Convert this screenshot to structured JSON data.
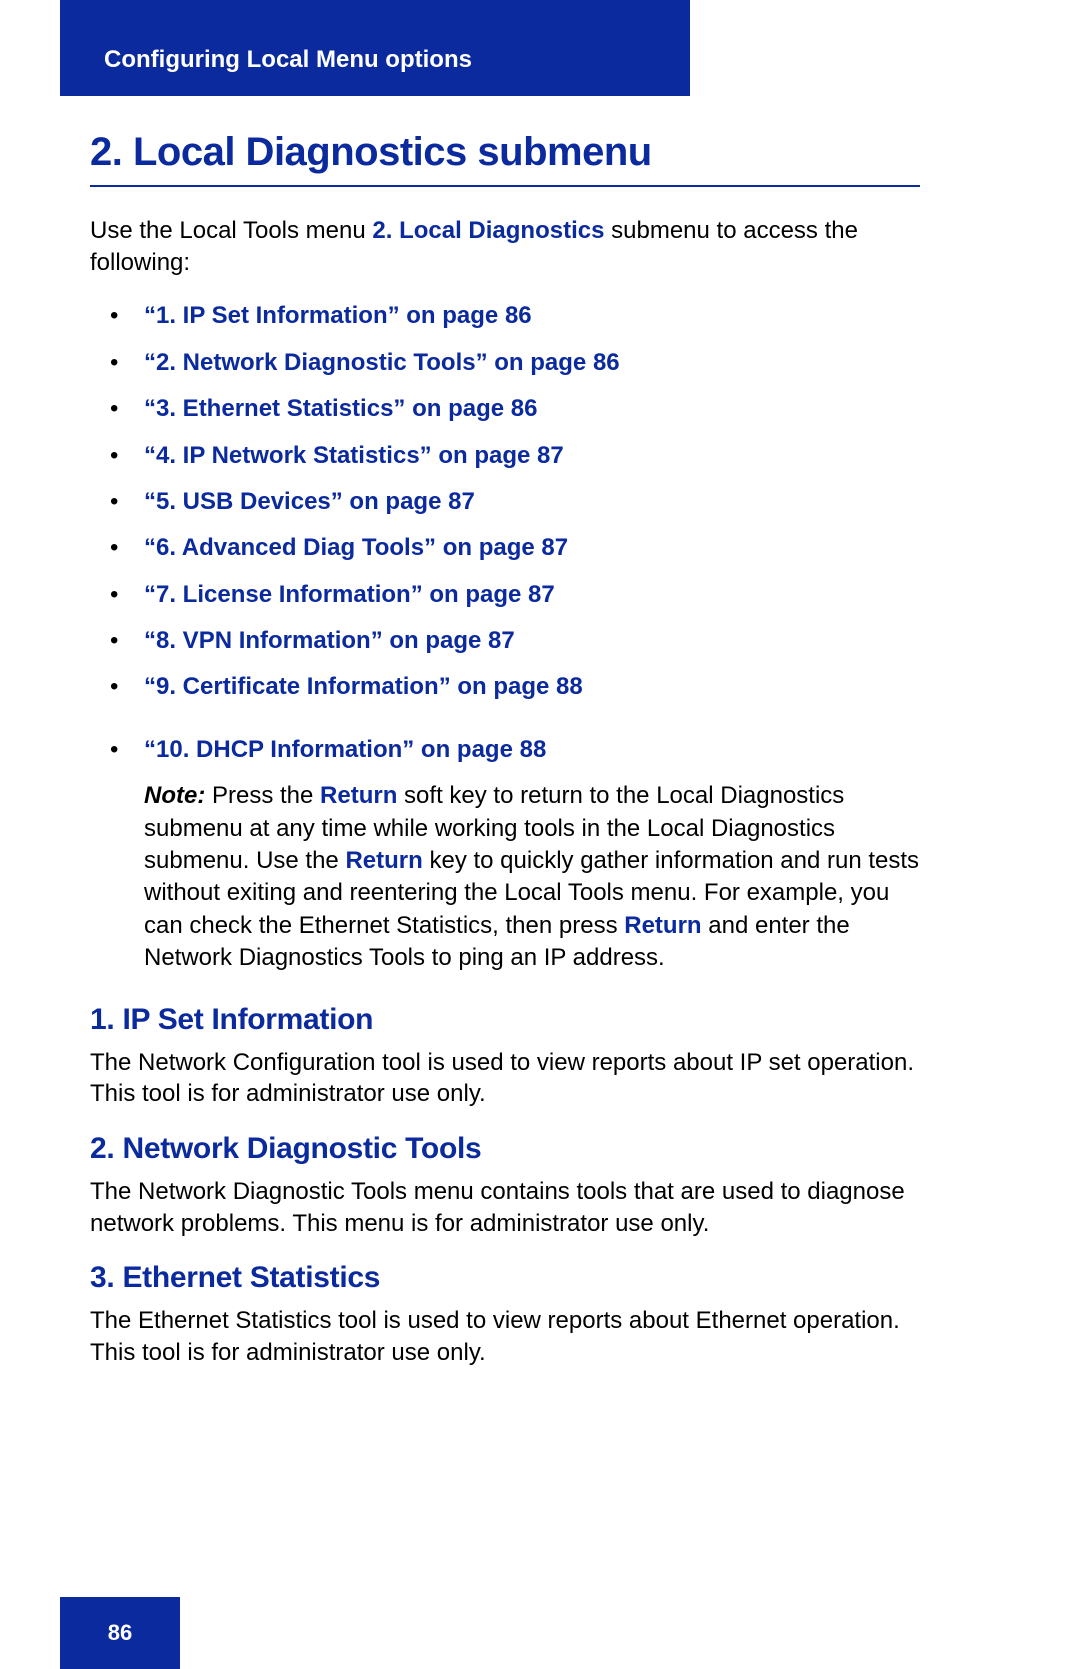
{
  "header": {
    "chapter": "Configuring Local Menu options"
  },
  "main": {
    "heading": "2. Local Diagnostics submenu",
    "intro_pre": "Use the Local Tools menu ",
    "intro_link": "2. Local Diagnostics",
    "intro_post": " submenu to access the following:",
    "links": [
      "“1. IP Set Information” on page 86",
      "“2. Network Diagnostic Tools” on page 86",
      "“3. Ethernet Statistics” on page 86",
      "“4. IP Network Statistics” on page 87",
      "“5. USB Devices” on page 87",
      "“6. Advanced Diag Tools” on page 87",
      "“7. License Information” on page 87",
      "“8. VPN Information” on page 87",
      "“9. Certificate Information” on page 88",
      "“10. DHCP Information” on page 88"
    ],
    "note": {
      "label": "Note:",
      "seg1": " Press the ",
      "return1": "Return",
      "seg2": " soft key to return to the Local Diagnostics submenu at any time while working tools in the Local Diagnostics submenu. Use the ",
      "return2": "Return",
      "seg3": " key to quickly gather information and run tests without exiting and reentering the Local Tools menu. For example, you can check the Ethernet Statistics, then press ",
      "return3": "Return",
      "seg4": " and enter the Network Diagnostics Tools to ping an IP address."
    },
    "sections": [
      {
        "heading": "1. IP Set Information",
        "body": "The Network Configuration tool is used to view reports about IP set operation. This tool is for administrator use only."
      },
      {
        "heading": "2. Network Diagnostic Tools",
        "body": "The Network Diagnostic Tools menu contains tools that are used to diagnose network problems. This menu is for administrator use only."
      },
      {
        "heading": "3. Ethernet Statistics",
        "body": "The Ethernet Statistics tool is used to view reports about Ethernet operation. This tool is for administrator use only."
      }
    ]
  },
  "footer": {
    "page": "86"
  }
}
